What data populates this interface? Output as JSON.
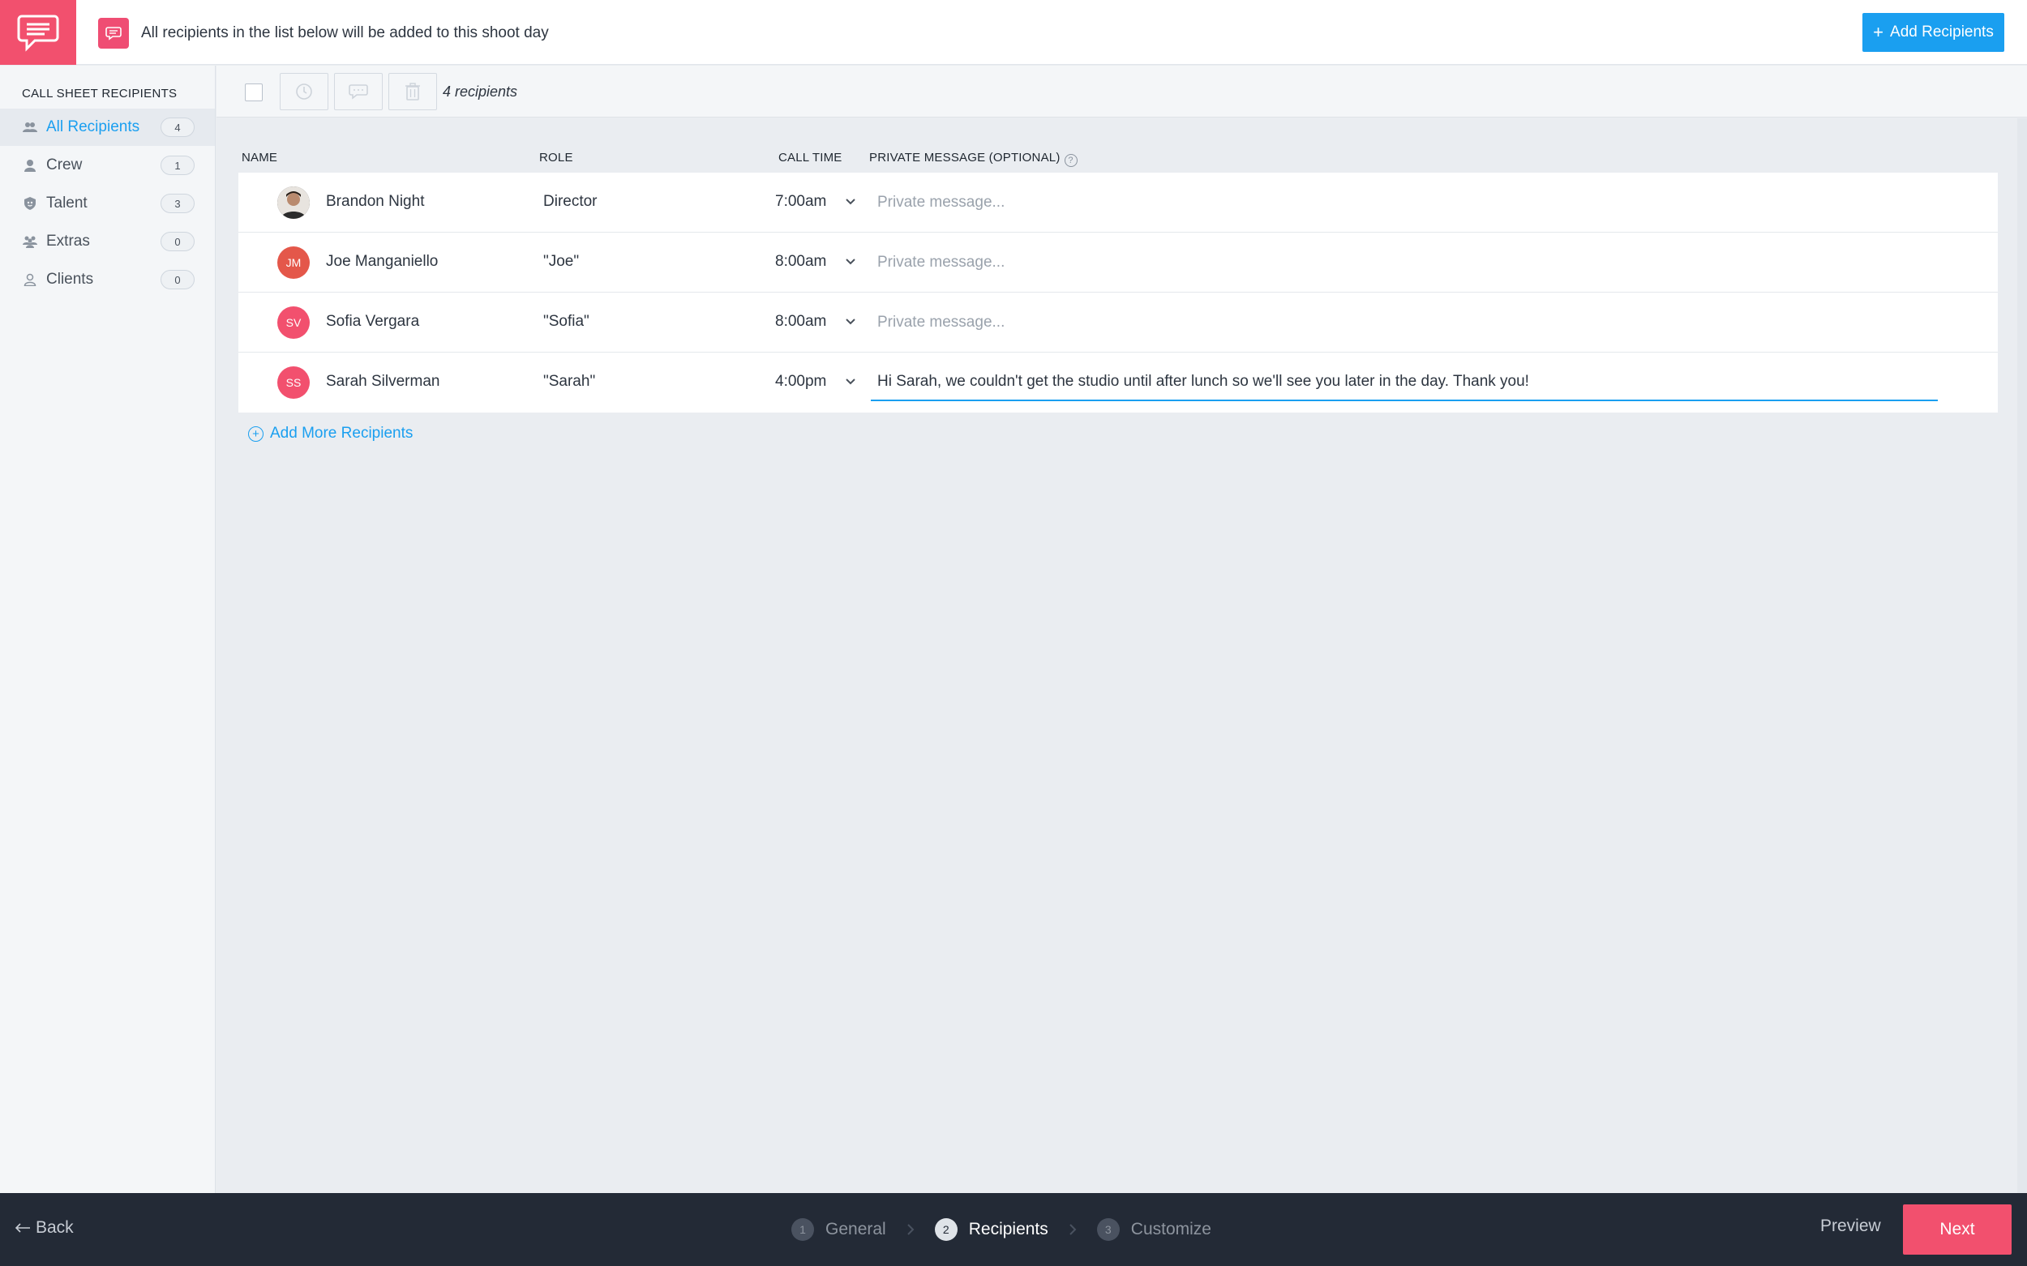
{
  "header": {
    "notice": "All recipients in the list below will be added to this shoot day",
    "add_button_label": "Add Recipients",
    "brand_color": "#f2506e",
    "accent_color": "#1a9ff0"
  },
  "sidebar": {
    "title": "CALL SHEET RECIPIENTS",
    "items": [
      {
        "label": "All Recipients",
        "count": "4",
        "icon": "group-icon",
        "active": true
      },
      {
        "label": "Crew",
        "count": "1",
        "icon": "person-icon",
        "active": false
      },
      {
        "label": "Talent",
        "count": "3",
        "icon": "shield-icon",
        "active": false
      },
      {
        "label": "Extras",
        "count": "0",
        "icon": "people-icon",
        "active": false
      },
      {
        "label": "Clients",
        "count": "0",
        "icon": "client-icon",
        "active": false
      }
    ]
  },
  "toolbar": {
    "count_label": "4 recipients",
    "buttons": [
      "clock-icon",
      "chat-icon",
      "trash-icon"
    ]
  },
  "table": {
    "columns": {
      "name": "NAME",
      "role": "ROLE",
      "call_time": "CALL TIME",
      "message": "PRIVATE MESSAGE (OPTIONAL)"
    },
    "message_placeholder": "Private message...",
    "rows": [
      {
        "name": "Brandon Night",
        "initials": "",
        "avatar_color": "#3a3a3a",
        "role": "Director",
        "call_time": "7:00am",
        "message": ""
      },
      {
        "name": "Joe Manganiello",
        "initials": "JM",
        "avatar_color": "#e4574a",
        "role": "\"Joe\"",
        "call_time": "8:00am",
        "message": ""
      },
      {
        "name": "Sofia Vergara",
        "initials": "SV",
        "avatar_color": "#f2506e",
        "role": "\"Sofia\"",
        "call_time": "8:00am",
        "message": ""
      },
      {
        "name": "Sarah Silverman",
        "initials": "SS",
        "avatar_color": "#f2506e",
        "role": "\"Sarah\"",
        "call_time": "4:00pm",
        "message": "Hi Sarah, we couldn't get the studio until after lunch so we'll see you later in the day. Thank you!"
      }
    ],
    "add_more_label": "Add More Recipients"
  },
  "footer": {
    "back_label": "Back",
    "steps": [
      {
        "num": "1",
        "label": "General",
        "current": false
      },
      {
        "num": "2",
        "label": "Recipients",
        "current": true
      },
      {
        "num": "3",
        "label": "Customize",
        "current": false
      }
    ],
    "preview_label": "Preview",
    "next_label": "Next"
  }
}
